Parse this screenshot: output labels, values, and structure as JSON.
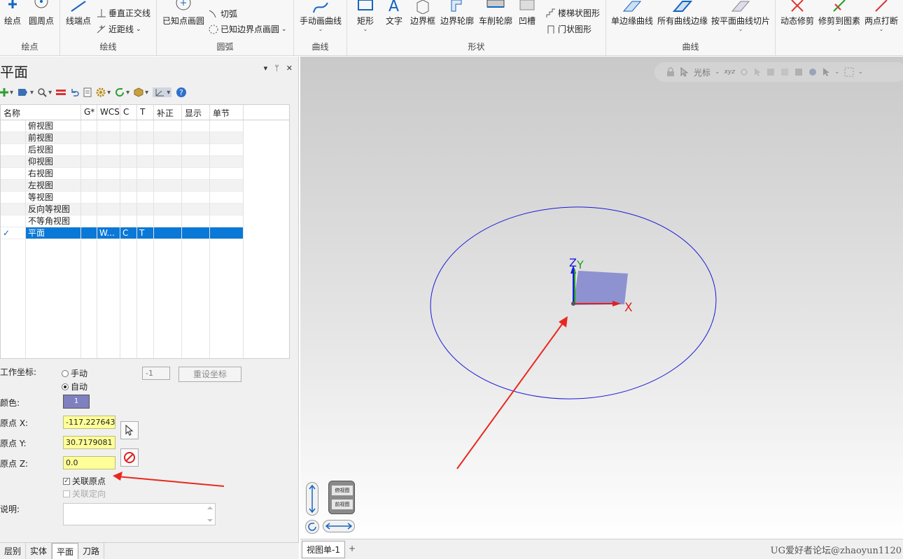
{
  "ribbon": {
    "groups": [
      {
        "label": "绘点",
        "buttons": [
          {
            "label": "绘点"
          },
          {
            "label": "圆周点"
          }
        ]
      },
      {
        "label": "绘线",
        "buttons": [
          {
            "label": "线端点"
          }
        ],
        "small": [
          {
            "label": "垂直正交线"
          },
          {
            "label": "近距线"
          }
        ]
      },
      {
        "label": "圆弧",
        "buttons": [
          {
            "label": "已知点画圆"
          }
        ],
        "small": [
          {
            "label": "切弧"
          },
          {
            "label": "已知边界点画圆"
          }
        ]
      },
      {
        "label": "曲线",
        "buttons": [
          {
            "label": "手动画曲线"
          }
        ]
      },
      {
        "label": "形状",
        "buttons": [
          {
            "label": "矩形"
          },
          {
            "label": "文字"
          },
          {
            "label": "边界框"
          },
          {
            "label": "边界轮廓"
          },
          {
            "label": "车削轮廓"
          },
          {
            "label": "凹槽"
          }
        ],
        "small": [
          {
            "label": "楼梯状图形"
          },
          {
            "label": "门状图形"
          }
        ]
      },
      {
        "label": "曲线",
        "buttons": [
          {
            "label": "单边缘曲线"
          },
          {
            "label": "所有曲线边缘"
          },
          {
            "label": "按平面曲线切片"
          }
        ]
      },
      {
        "label": "",
        "buttons": [
          {
            "label": "动态修剪"
          },
          {
            "label": "修剪到图素"
          },
          {
            "label": "两点打断"
          }
        ]
      }
    ]
  },
  "panel": {
    "title": "平面",
    "controls": [
      "▾",
      "ᛘ",
      "✕"
    ],
    "table": {
      "columns": [
        "名称",
        "G*",
        "WCS",
        "C",
        "T",
        "补正",
        "显示",
        "单节"
      ],
      "rows": [
        {
          "check": "",
          "name": "俯视图",
          "wcs": "",
          "c": "",
          "t": ""
        },
        {
          "check": "",
          "name": "前视图",
          "wcs": "",
          "c": "",
          "t": ""
        },
        {
          "check": "",
          "name": "后视图",
          "wcs": "",
          "c": "",
          "t": ""
        },
        {
          "check": "",
          "name": "仰视图",
          "wcs": "",
          "c": "",
          "t": ""
        },
        {
          "check": "",
          "name": "右视图",
          "wcs": "",
          "c": "",
          "t": ""
        },
        {
          "check": "",
          "name": "左视图",
          "wcs": "",
          "c": "",
          "t": ""
        },
        {
          "check": "",
          "name": "等视图",
          "wcs": "",
          "c": "",
          "t": ""
        },
        {
          "check": "",
          "name": "反向等视图",
          "wcs": "",
          "c": "",
          "t": ""
        },
        {
          "check": "",
          "name": "不等角视图",
          "wcs": "",
          "c": "",
          "t": ""
        },
        {
          "check": "✓",
          "name": "平面",
          "wcs": "W...",
          "c": "C",
          "t": "T",
          "selected": true
        }
      ]
    },
    "work_coord": {
      "label": "工作坐标:",
      "manual": "手动",
      "auto": "自动",
      "selected": "自动",
      "number": "-1",
      "reset_button": "重设坐标"
    },
    "color": {
      "label": "颜色:",
      "value": "1",
      "swatch": "#7f80c0"
    },
    "origin_x": {
      "label": "原点 X:",
      "value": "-117.2276437"
    },
    "origin_y": {
      "label": "原点 Y:",
      "value": "30.7179081"
    },
    "origin_z": {
      "label": "原点 Z:",
      "value": "0.0"
    },
    "link_origin": {
      "label": "关联原点",
      "checked": true
    },
    "link_orient": {
      "label": "关联定向",
      "checked": false
    },
    "description": {
      "label": "说明:"
    },
    "bottom_tabs": [
      "层别",
      "实体",
      "平面",
      "刀路"
    ],
    "active_tab": "平面"
  },
  "viewport": {
    "toolbar_label": "光标",
    "axis_labels": {
      "x": "X",
      "y": "Y",
      "z": "Z"
    },
    "cube_labels": [
      "俯视图",
      "前视图"
    ],
    "tab": "视图单-1",
    "tab_add": "+",
    "watermark": "UG爱好者论坛@zhaoyun1120",
    "colors": {
      "x": "#e02020",
      "y": "#1fa01f",
      "z": "#1a1ae0",
      "circle": "#1a1ad6",
      "annotation": "#e8281e"
    }
  }
}
